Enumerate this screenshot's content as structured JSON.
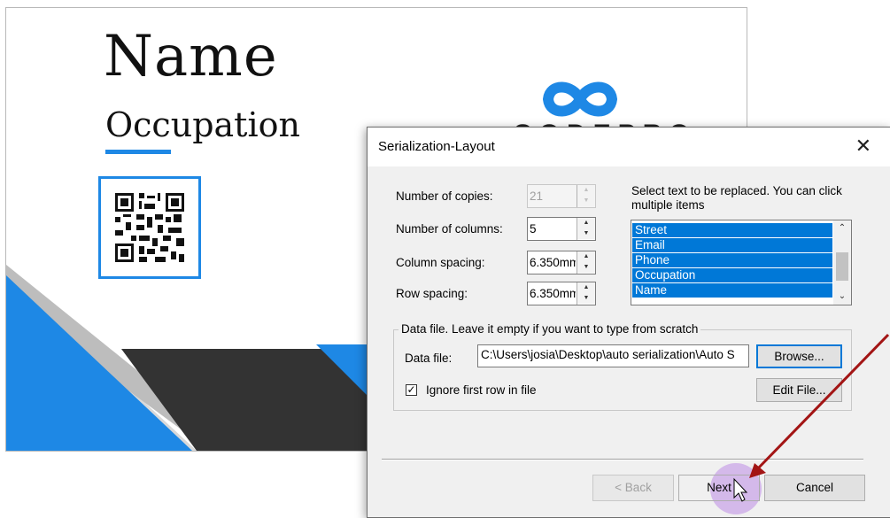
{
  "card": {
    "name": "Name",
    "occupation": "Occupation",
    "logo_text": "CODEPRO",
    "accent_color": "#1e88e5",
    "dark_color": "#333333"
  },
  "dialog": {
    "title": "Serialization-Layout",
    "close_icon": "close-icon",
    "fields": {
      "copies_label": "Number of copies:",
      "copies_value": "21",
      "columns_label": "Number of columns:",
      "columns_value": "5",
      "column_spacing_label": "Column spacing:",
      "column_spacing_value": "6.350mm",
      "row_spacing_label": "Row spacing:",
      "row_spacing_value": "6.350mm"
    },
    "select_text_label": "Select text to be replaced. You can click multiple items",
    "list_items": [
      "Street",
      "Email",
      "Phone",
      "Occupation",
      "Name"
    ],
    "data_file_group_title": "Data file. Leave it empty if you want to type from scratch",
    "data_file_label": "Data file:",
    "data_file_value": "C:\\Users\\josia\\Desktop\\auto serialization\\Auto S",
    "browse_label": "Browse...",
    "ignore_first_row_label": "Ignore first row in file",
    "ignore_first_row_checked": true,
    "edit_file_label": "Edit File...",
    "back_label": "< Back",
    "next_label": "Next",
    "cancel_label": "Cancel",
    "selection_color": "#0078d7",
    "annotation_arrow_color": "#a31515"
  }
}
